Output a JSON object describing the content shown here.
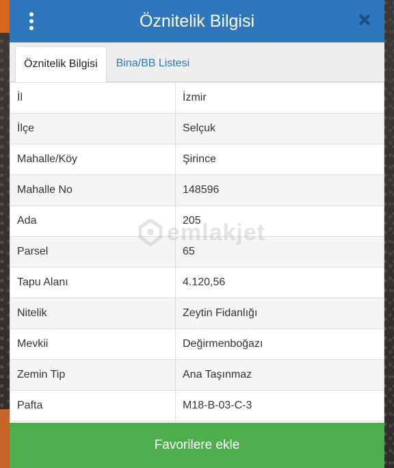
{
  "header": {
    "title": "Öznitelik Bilgisi"
  },
  "tabs": [
    {
      "label": "Öznitelik Bilgisi",
      "active": true
    },
    {
      "label": "Bina/BB Listesi",
      "active": false
    }
  ],
  "rows": [
    {
      "key": "İl",
      "value": "İzmir"
    },
    {
      "key": "İlçe",
      "value": "Selçuk"
    },
    {
      "key": "Mahalle/Köy",
      "value": "Şirince"
    },
    {
      "key": "Mahalle No",
      "value": "148596"
    },
    {
      "key": "Ada",
      "value": "205"
    },
    {
      "key": "Parsel",
      "value": "65"
    },
    {
      "key": "Tapu Alanı",
      "value": "4.120,56"
    },
    {
      "key": "Nitelik",
      "value": "Zeytin Fidanlığı"
    },
    {
      "key": "Mevkii",
      "value": "Değirmenboğazı"
    },
    {
      "key": "Zemin Tip",
      "value": "Ana Taşınmaz"
    },
    {
      "key": "Pafta",
      "value": "M18-B-03-C-3"
    }
  ],
  "watermark": {
    "text": "emlakjet"
  },
  "footer": {
    "favorite_label": "Favorilere ekle"
  },
  "colors": {
    "header": "#2e77bd",
    "button": "#4cae4c"
  }
}
